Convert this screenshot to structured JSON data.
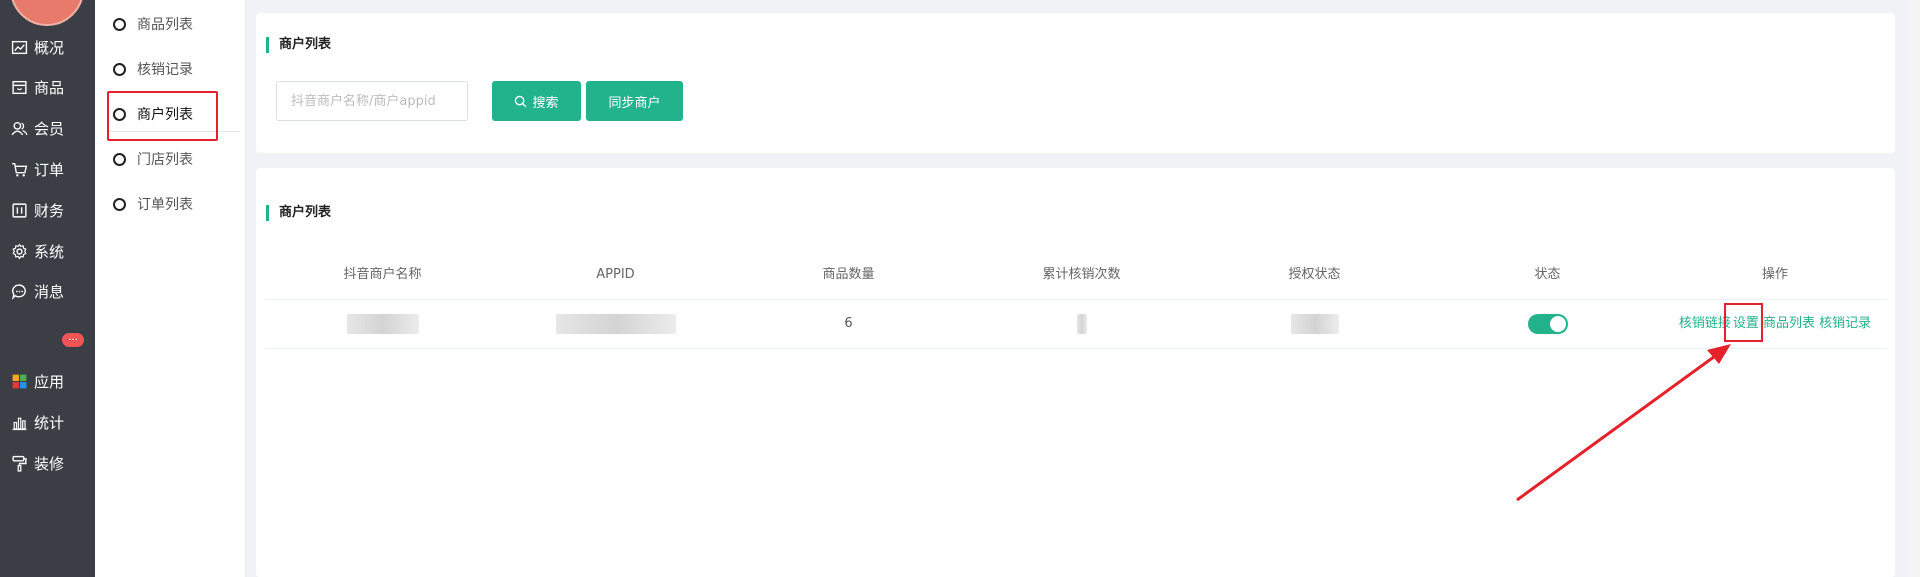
{
  "sidebar": {
    "items": [
      {
        "label": "概况",
        "icon": "trend-chart-icon"
      },
      {
        "label": "商品",
        "icon": "shop-icon"
      },
      {
        "label": "会员",
        "icon": "users-icon"
      },
      {
        "label": "订单",
        "icon": "cart-icon"
      },
      {
        "label": "财务",
        "icon": "wallet-icon"
      },
      {
        "label": "系统",
        "icon": "gear-icon"
      },
      {
        "label": "消息",
        "icon": "chat-icon"
      },
      {
        "label": "应用",
        "icon": "apps-grid-icon"
      },
      {
        "label": "统计",
        "icon": "bar-chart-icon"
      },
      {
        "label": "装修",
        "icon": "paint-roller-icon"
      }
    ],
    "message_badge": "..."
  },
  "submenu": {
    "items": [
      {
        "label": "商品列表"
      },
      {
        "label": "核销记录"
      },
      {
        "label": "商户列表",
        "active": true
      },
      {
        "label": "门店列表"
      },
      {
        "label": "订单列表"
      }
    ]
  },
  "search_card": {
    "title": "商户列表",
    "search_placeholder": "抖音商户名称/商户appid",
    "search_value": "",
    "search_button": "搜索",
    "sync_button": "同步商户"
  },
  "list_card": {
    "title": "商户列表",
    "columns": [
      "抖音商户名称",
      "APPID",
      "商品数量",
      "累计核销次数",
      "授权状态",
      "状态",
      "操作"
    ],
    "rows": [
      {
        "product_count": "6",
        "status_on": true,
        "actions": [
          "核销链接",
          "设置",
          "商品列表",
          "核销记录"
        ]
      }
    ]
  },
  "colors": {
    "accent": "#22b28c",
    "sidebar_bg": "#3b3f45",
    "annotation_red": "#e5222b"
  }
}
